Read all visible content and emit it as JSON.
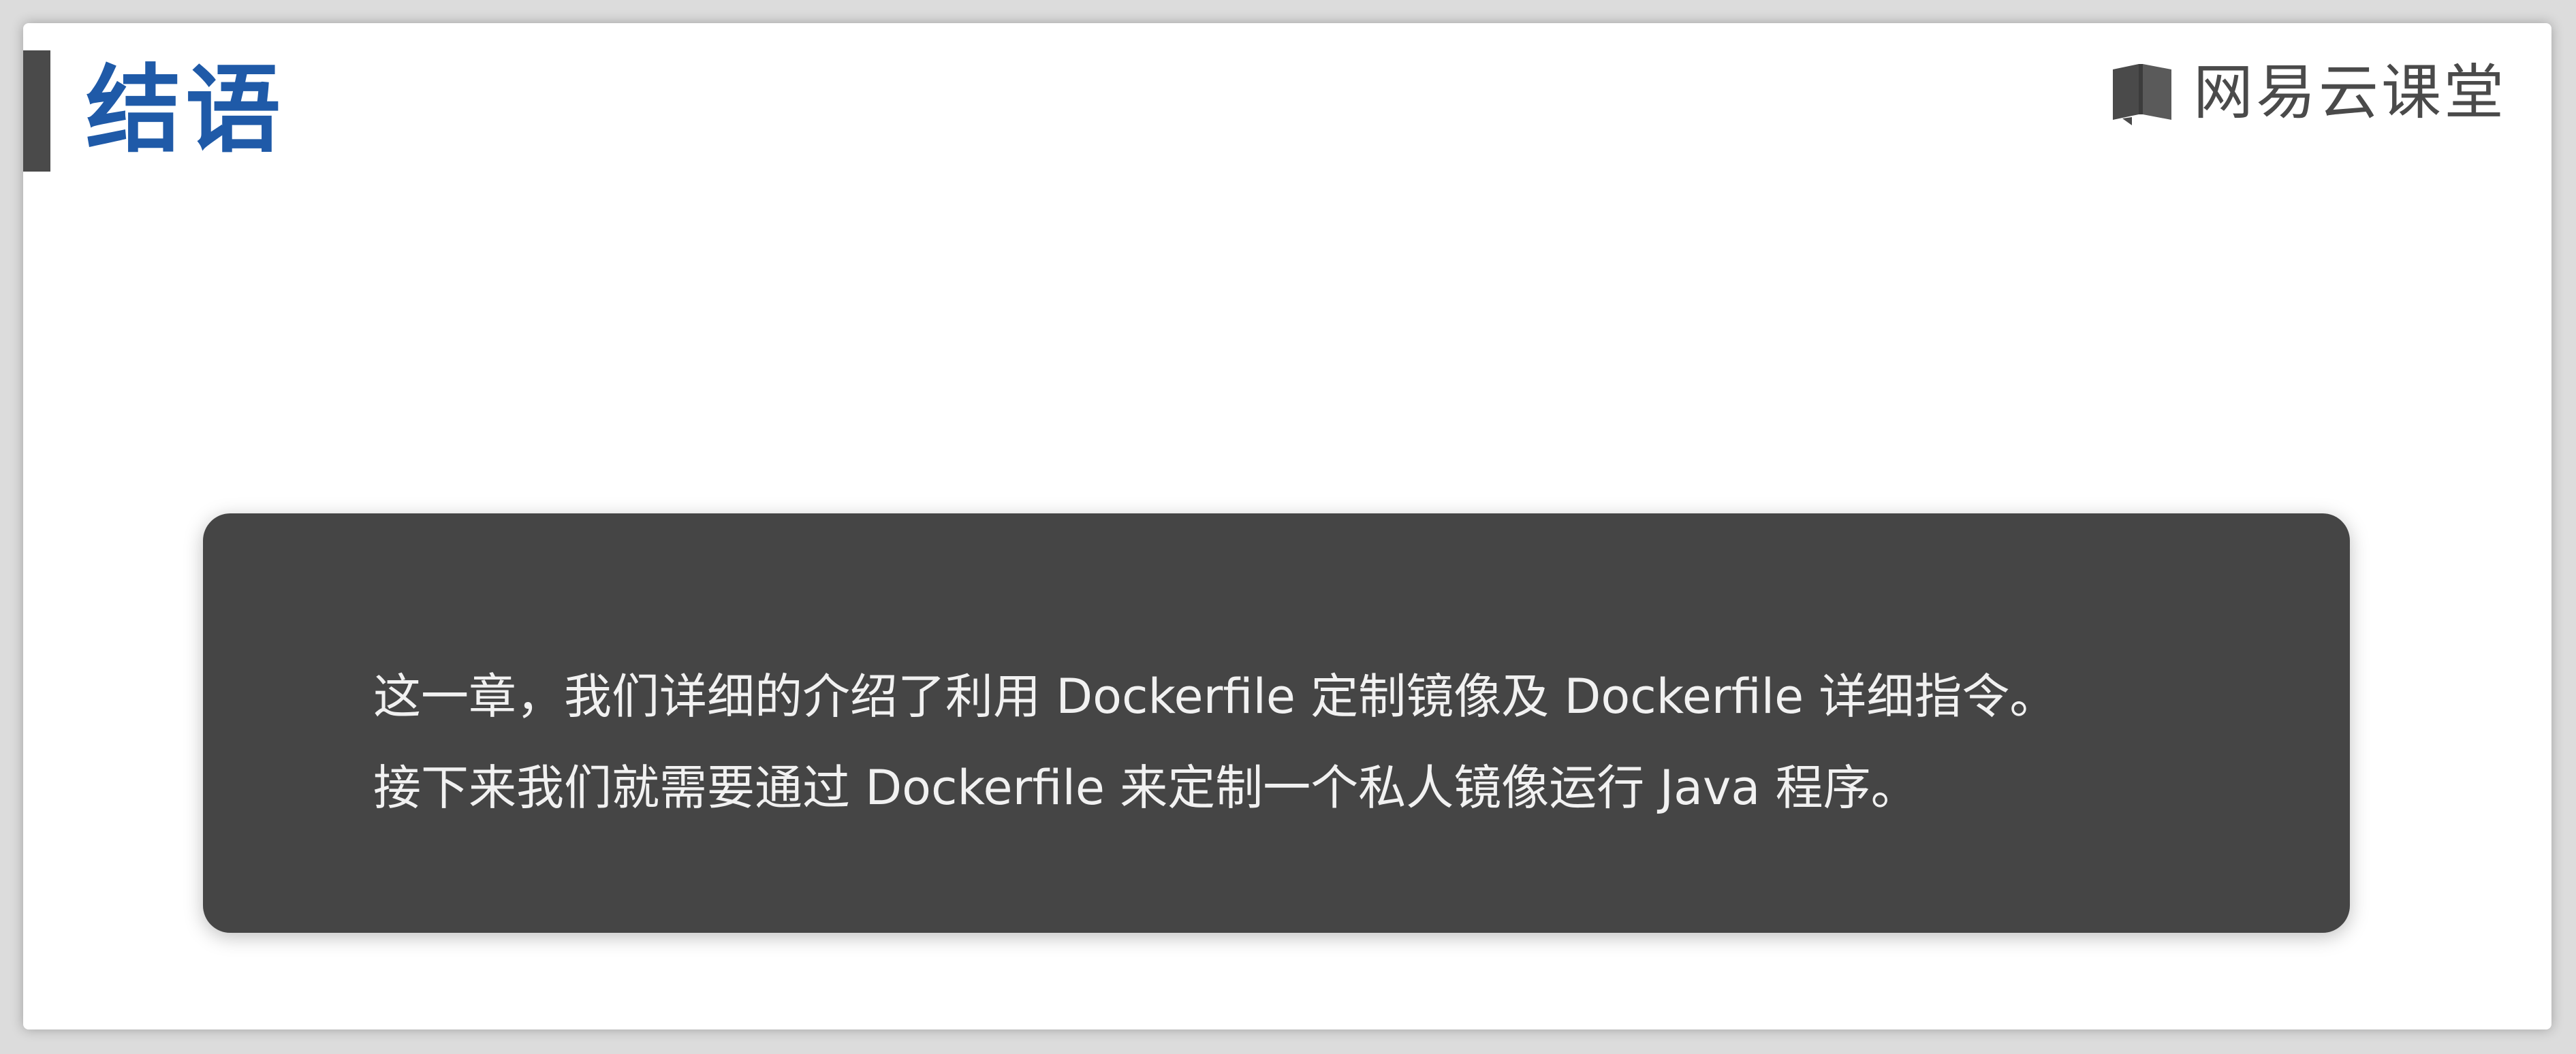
{
  "slide": {
    "title": "结语",
    "brand": {
      "icon": "netease-cloud-classroom-book-icon",
      "name": "网易云课堂"
    },
    "summary": {
      "lines": [
        "这一章，我们详细的介绍了利用 Dockerfile 定制镜像及 Dockerfile 详细指令。",
        "接下来我们就需要通过 Dockerfile 来定制一个私人镜像运行 Java 程序。"
      ]
    }
  },
  "colors": {
    "title": "#1f5aa8",
    "accent_bar": "#4a4a4a",
    "card_background": "#454545",
    "card_text": "#f1f1f1",
    "brand_text": "#4a4a4a"
  }
}
